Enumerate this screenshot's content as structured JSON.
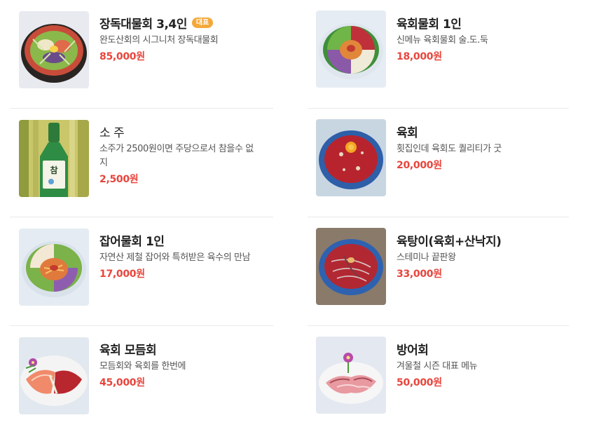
{
  "menu": {
    "items": [
      {
        "name": "장독대물회 3,4인",
        "badge": "대표",
        "desc": "완도산회의 시그니처 장독대물회",
        "price": "85,000원",
        "image": "jangdok-mulhoe-photo"
      },
      {
        "name": "육회물회 1인",
        "badge": "",
        "desc": "신메뉴 육회물회 술.도.둑",
        "price": "18,000원",
        "image": "yukhoe-mulhoe-photo"
      },
      {
        "name": "소 주",
        "badge": "",
        "desc": "소주가 2500원이면 주당으로서 참을수 없지",
        "price": "2,500원",
        "image": "soju-bottle-photo"
      },
      {
        "name": "육회",
        "badge": "",
        "desc": "횟집인데 육회도 퀄리티가 굿",
        "price": "20,000원",
        "image": "yukhoe-photo"
      },
      {
        "name": "잡어물회 1인",
        "badge": "",
        "desc": "자연산 제철 잡어와 특허받은 육수의 만남",
        "price": "17,000원",
        "image": "jabeo-mulhoe-photo"
      },
      {
        "name": "육탕이(육회+산낙지)",
        "badge": "",
        "desc": "스테미나 끝판왕",
        "price": "33,000원",
        "image": "yuktangi-photo"
      },
      {
        "name": "육회 모듬회",
        "badge": "",
        "desc": "모듬회와 육회를 한번에",
        "price": "45,000원",
        "image": "yukhoe-modeumhoe-photo"
      },
      {
        "name": "방어회",
        "badge": "",
        "desc": "겨울철 시즌 대표 메뉴",
        "price": "50,000원",
        "image": "bangeo-hoe-photo"
      }
    ]
  },
  "colors": {
    "price": "#e8453c",
    "badge": "#f4a83a",
    "divider": "#e9e9e9"
  }
}
